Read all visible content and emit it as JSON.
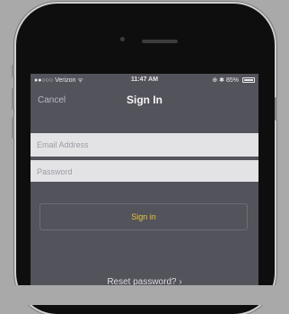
{
  "status_bar": {
    "carrier": "●●○○○ Verizon ᯤ",
    "time": "11:47 AM",
    "right": "⊕ ✱ 85%"
  },
  "nav": {
    "cancel_label": "Cancel",
    "title": "Sign In"
  },
  "form": {
    "email_placeholder": "Email Address",
    "password_placeholder": "Password",
    "signin_label": "Sign in"
  },
  "reset_label": "Reset password? ›",
  "colors": {
    "accent": "#e8c33a",
    "screen_bg": "#53535b",
    "field_bg": "#e3e3e6"
  }
}
